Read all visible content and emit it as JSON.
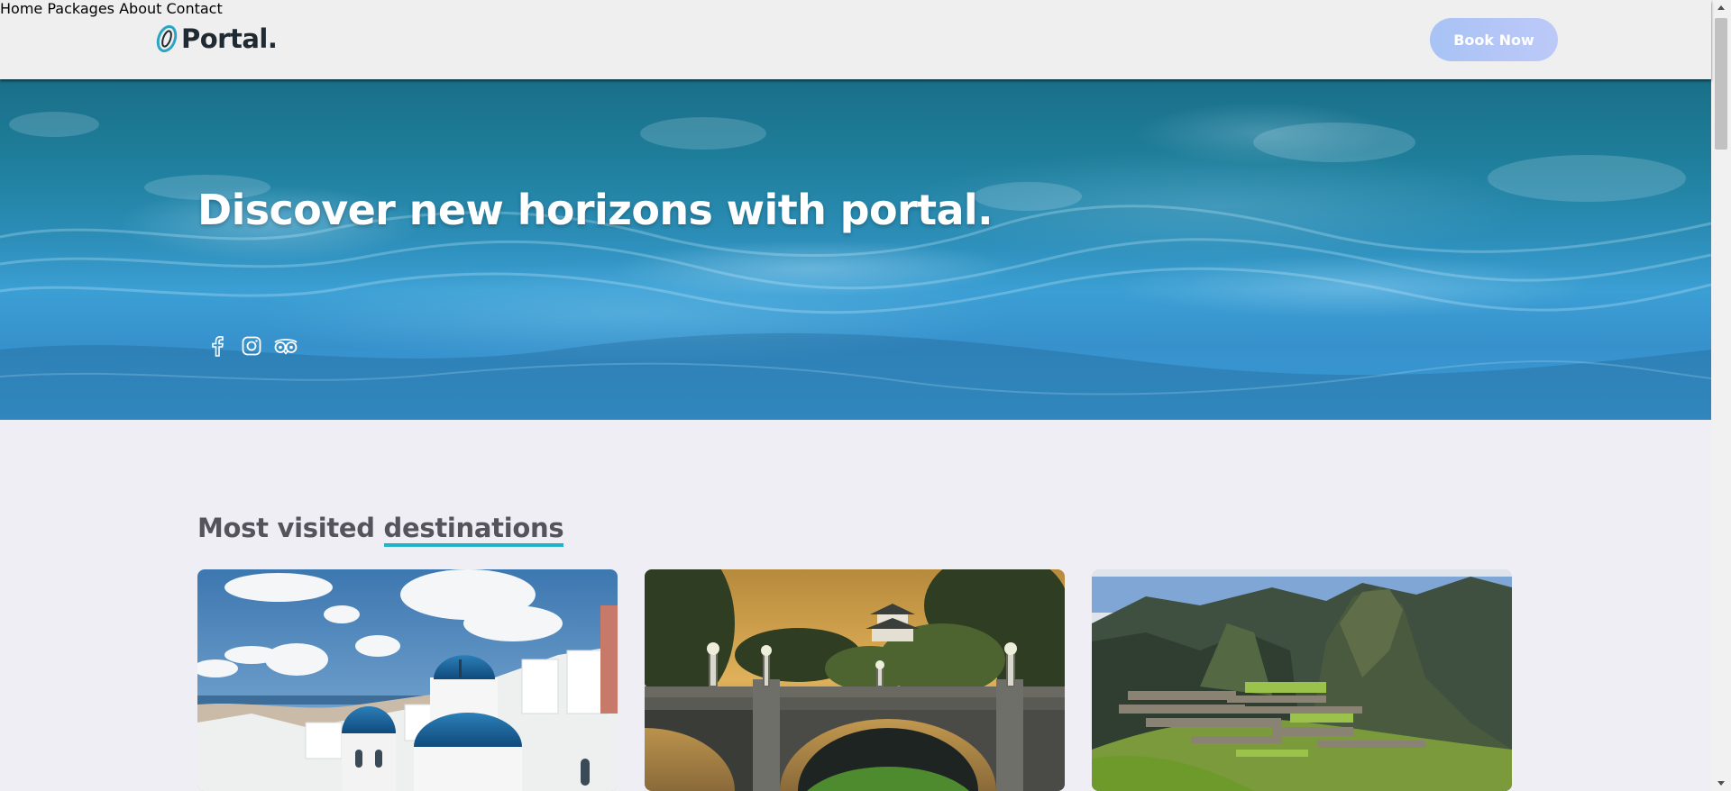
{
  "header": {
    "logo_text": "Portal.",
    "nav": [
      {
        "label": "Home"
      },
      {
        "label": "Packages"
      },
      {
        "label": "About"
      },
      {
        "label": "Contact"
      }
    ],
    "book_button": "Book Now"
  },
  "hero": {
    "title": "Discover new horizons with portal.",
    "social_icons": [
      "facebook-icon",
      "instagram-icon",
      "tripadvisor-icon"
    ]
  },
  "destinations": {
    "title_prefix": "Most visited",
    "title_highlight": "destinations",
    "cards": [
      {
        "image": "santorini-blue-domes"
      },
      {
        "image": "tokyo-imperial-palace-bridge"
      },
      {
        "image": "machu-picchu-ruins"
      }
    ]
  },
  "colors": {
    "accent": "#21b3c8",
    "button_gradient_start": "#a7c3f4",
    "button_gradient_end": "#bcc9f8",
    "header_bg": "#efefef",
    "page_bg": "#efeef4"
  }
}
